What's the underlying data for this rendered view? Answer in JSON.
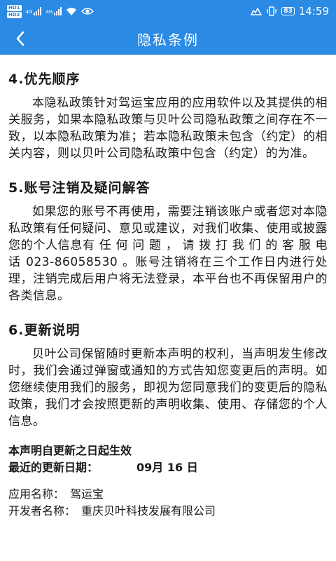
{
  "status_bar": {
    "hd1": "HD1",
    "hd2": "HD2",
    "net1": "4G",
    "net2": "4G",
    "battery": "83",
    "time": "14:59"
  },
  "app_bar": {
    "back_icon": "chevron-left-icon",
    "title": "隐私条例"
  },
  "sections": [
    {
      "title": "4.优先顺序",
      "text": "本隐私政策针对驾运宝应用的应用软件以及其提供的相关服务，如果本隐私政策与贝叶公司隐私政策之间存在不一致，以本隐私政策为准；若本隐私政策未包含（约定）的相关内容，则以贝叶公司隐私政策中包含（约定）的为准。"
    },
    {
      "title": "5.账号注销及疑问解答",
      "text": "如果您的账号不再使用，需要注销该账户或者您对本隐私政策有任何疑问、意见或建议，对我们收集、使用或披露您的个人信息有 任 何 问 题 ， 请 拨 打 我 们 的 客 服 电 话 023-86058530 。账号注销将在三个工作日内进行处理，注销完成后用户将无法登录，本平台也不再保留用户的各类信息。"
    },
    {
      "title": "6.更新说明",
      "text": "贝叶公司保留随时更新本声明的权利，当声明发生修改时，我们会通过弹窗或通知的方式告知您变更后的声明。如您继续使用我们的服务，即视为您同意我们的变更后的隐私政策，我们才会按照更新的声明收集、使用、存储您的个人信息。"
    }
  ],
  "effective": {
    "statement": "本声明自更新之日起生效",
    "update_label": "最近的更新日期：",
    "update_value": "09月 16 日"
  },
  "app_info": {
    "app_name_label": "应用名称：",
    "app_name_value": "驾运宝",
    "developer_label": "开发者名称：",
    "developer_value": "重庆贝叶科技发展有限公司"
  }
}
